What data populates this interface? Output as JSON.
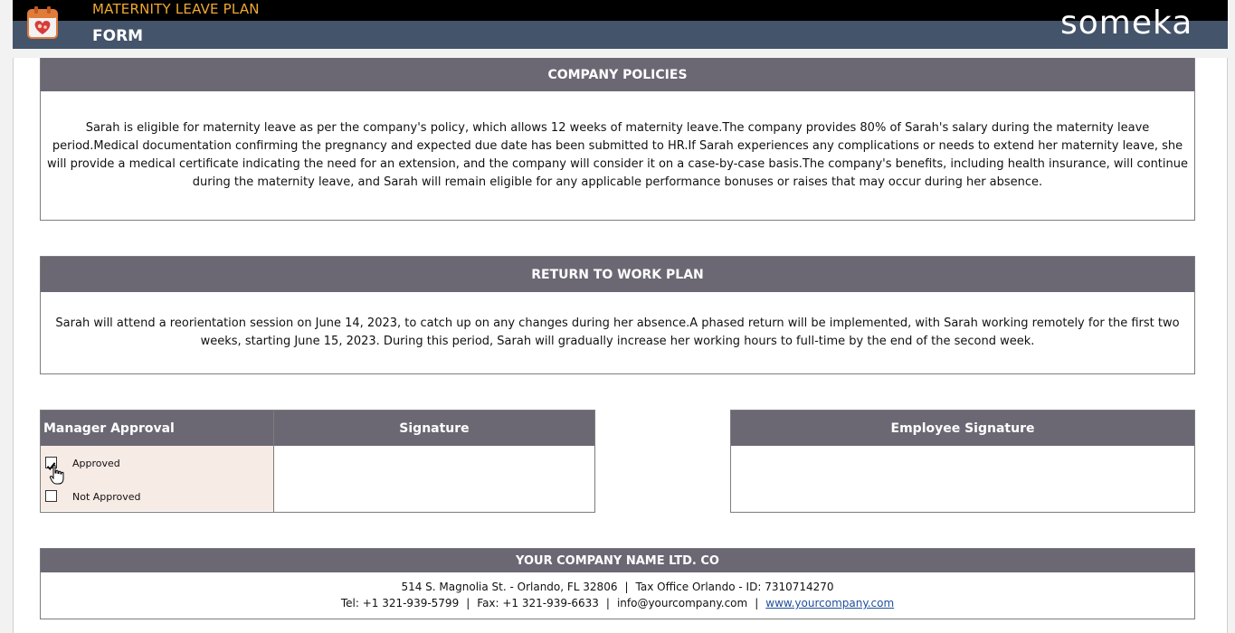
{
  "header": {
    "app_title": "MATERNITY LEAVE PLAN",
    "page_title": "FORM",
    "brand": "someka",
    "icon": "calendar-heart-icon"
  },
  "colors": {
    "title_accent": "#f0a830",
    "header_bar": "#44546a",
    "section_header": "#6b6874",
    "approval_background": "#f7ebe6"
  },
  "company_policies": {
    "heading": "COMPANY POLICIES",
    "text": "Sarah is eligible for maternity leave as per the company's policy, which allows 12 weeks of maternity leave.The company provides 80% of Sarah's salary during the maternity leave period.Medical documentation confirming the pregnancy and expected due date has been submitted to HR.If Sarah experiences any complications or needs to extend her maternity leave, she will provide a medical certificate indicating the need for an extension, and the company will consider it on a case-by-case basis.The company's benefits, including health insurance, will continue during the maternity leave, and Sarah will remain eligible for any applicable performance bonuses or raises that may occur during her absence."
  },
  "return_plan": {
    "heading": "RETURN TO WORK PLAN",
    "text": "Sarah will attend a reorientation session on June 14, 2023, to catch up on any changes during her absence.A phased return will be implemented, with Sarah working remotely for the first two weeks, starting June 15, 2023. During this period, Sarah will gradually increase her working hours to full-time by the end of the second week."
  },
  "approval": {
    "heading": "Manager Approval",
    "signature_heading": "Signature",
    "options": [
      {
        "label": "Approved",
        "checked": true
      },
      {
        "label": "Not Approved",
        "checked": false
      }
    ]
  },
  "employee": {
    "signature_heading": "Employee Signature"
  },
  "footer": {
    "company_name": "YOUR COMPANY NAME LTD. CO",
    "address": "514 S. Magnolia St. - Orlando, FL 32806",
    "tax": "Tax Office Orlando - ID: 7310714270",
    "tel": "Tel: +1 321-939-5799",
    "fax": "Fax: +1 321-939-6633",
    "email": "info@yourcompany.com",
    "website": "www.yourcompany.com"
  }
}
